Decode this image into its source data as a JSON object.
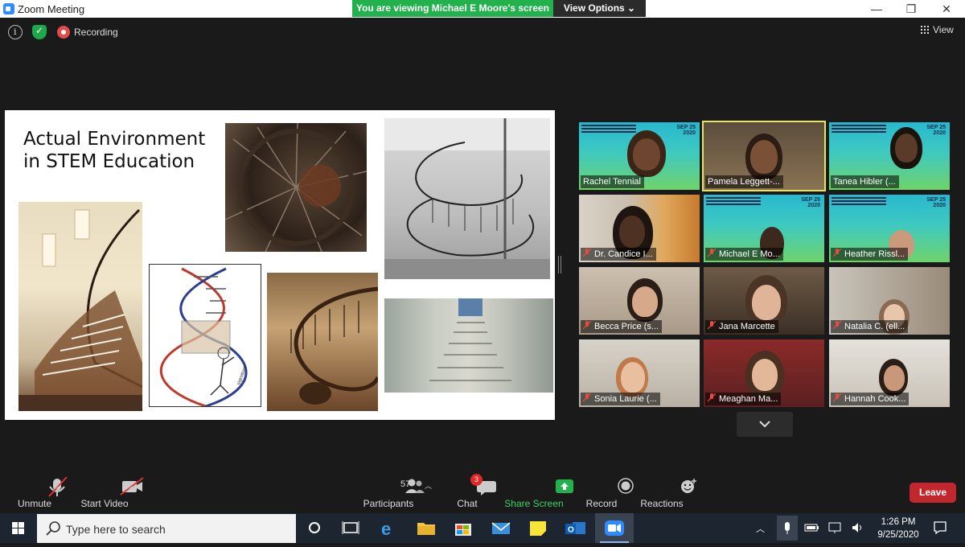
{
  "window": {
    "title": "Zoom Meeting",
    "viewing_banner": "You are viewing Michael E Moore's screen",
    "view_options": "View Options ⌄",
    "minimize": "—",
    "maximize": "❐",
    "close": "✕"
  },
  "topbar": {
    "recording": "Recording",
    "view": "View"
  },
  "slide": {
    "title": "Actual Environment in STEM Education"
  },
  "gallery": {
    "participants": [
      {
        "name": "Rachel Tennial",
        "muted": false
      },
      {
        "name": "Pamela Leggett-...",
        "muted": false
      },
      {
        "name": "Tanea Hibler (...",
        "muted": false
      },
      {
        "name": "Dr. Candice I...",
        "muted": true
      },
      {
        "name": "Michael E Mo...",
        "muted": true
      },
      {
        "name": "Heather Rissl...",
        "muted": true
      },
      {
        "name": "Becca Price (s...",
        "muted": true
      },
      {
        "name": "Jana Marcette",
        "muted": true
      },
      {
        "name": "Natalia C. (ell...",
        "muted": true
      },
      {
        "name": "Sonia Laurie (...",
        "muted": true
      },
      {
        "name": "Meaghan Ma...",
        "muted": true
      },
      {
        "name": "Hannah Cook...",
        "muted": true
      }
    ],
    "poster_date": "SEP 25\n2020",
    "poster_heading": "FORMING RESEARCH TEAMS TO ADDRESS INSTITUTIONAL RACISM IN STEM"
  },
  "toolbar": {
    "unmute": "Unmute",
    "start_video": "Start Video",
    "participants_count": "57",
    "participants": "Participants",
    "chat": "Chat",
    "chat_badge": "3",
    "share_screen": "Share Screen",
    "record": "Record",
    "reactions": "Reactions",
    "leave": "Leave"
  },
  "taskbar": {
    "search_placeholder": "Type here to search",
    "time": "1:26 PM",
    "date": "9/25/2020"
  },
  "colors": {
    "share_green": "#23b14d",
    "leave_red": "#c1272d",
    "active_speaker": "#e6e65a"
  }
}
